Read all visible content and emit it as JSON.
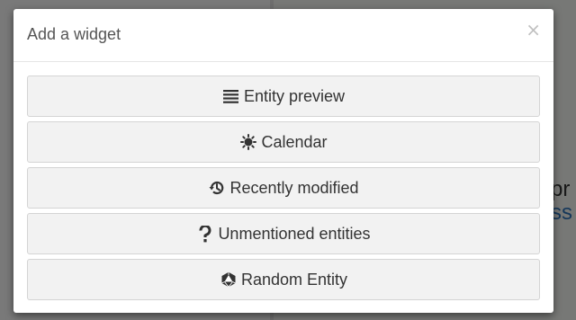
{
  "modal": {
    "title": "Add a widget",
    "close_label": "×"
  },
  "widgets": [
    {
      "label": "Entity preview",
      "icon": "list-icon"
    },
    {
      "label": "Calendar",
      "icon": "sun-icon"
    },
    {
      "label": "Recently modified",
      "icon": "history-icon"
    },
    {
      "label": "Unmentioned entities",
      "icon": "question-icon"
    },
    {
      "label": "Random Entity",
      "icon": "d20-dice-icon"
    }
  ],
  "background": {
    "text_line1": "pr",
    "text_line2": "ss"
  },
  "colors": {
    "overlay": "#000000",
    "button_bg": "#f2f2f2",
    "button_border": "#d4d4d4",
    "text": "#333333"
  }
}
